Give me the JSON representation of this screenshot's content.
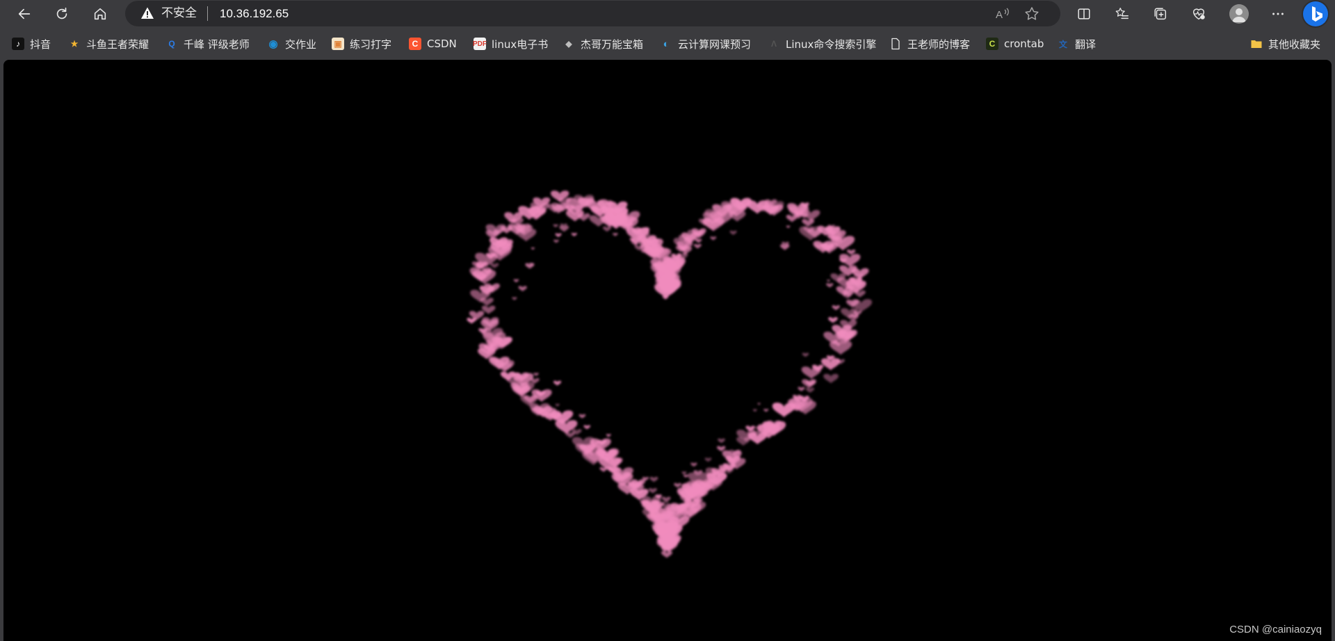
{
  "browser": {
    "address": {
      "security_label": "不安全",
      "url": "10.36.192.65"
    }
  },
  "bookmarks": [
    {
      "label": "抖音",
      "icon": "tiktok-icon",
      "color": "#ffffff",
      "glyph": "♪"
    },
    {
      "label": "斗鱼王者荣耀",
      "icon": "douyu-icon",
      "color": "#f2b531",
      "glyph": "★"
    },
    {
      "label": "千峰 评级老师",
      "icon": "qianfeng-icon",
      "color": "#2b7de9",
      "glyph": "Q"
    },
    {
      "label": "交作业",
      "icon": "homework-icon",
      "color": "#1e8fd6",
      "glyph": "◉"
    },
    {
      "label": "练习打字",
      "icon": "typing-icon",
      "color": "#e0843a",
      "glyph": "▣"
    },
    {
      "label": "CSDN",
      "icon": "csdn-icon",
      "color": "#fc5531",
      "glyph": "C"
    },
    {
      "label": "linux电子书",
      "icon": "pdf-icon",
      "color": "#d93a2f",
      "glyph": "P"
    },
    {
      "label": "杰哥万能宝箱",
      "icon": "treasure-icon",
      "color": "#9a9a9a",
      "glyph": "◆"
    },
    {
      "label": "云计算网课预习",
      "icon": "cloud-course-icon",
      "color": "#3aa0e0",
      "glyph": "◐"
    },
    {
      "label": "Linux命令搜索引擎",
      "icon": "linux-search-icon",
      "color": "#555555",
      "glyph": "Λ"
    },
    {
      "label": "王老师的博客",
      "icon": "page-icon",
      "color": "#e8e8e8",
      "glyph": ""
    },
    {
      "label": "crontab",
      "icon": "crontab-icon",
      "color": "#c8e04a",
      "glyph": "C"
    },
    {
      "label": "翻译",
      "icon": "translate-icon",
      "color": "#2266bb",
      "glyph": "文"
    }
  ],
  "other_bookmarks": {
    "label": "其他收藏夹",
    "icon": "folder-icon",
    "color": "#f3c347"
  },
  "content": {
    "heart_color": "#f08bbd",
    "watermark": "CSDN @cainiaozyq"
  }
}
